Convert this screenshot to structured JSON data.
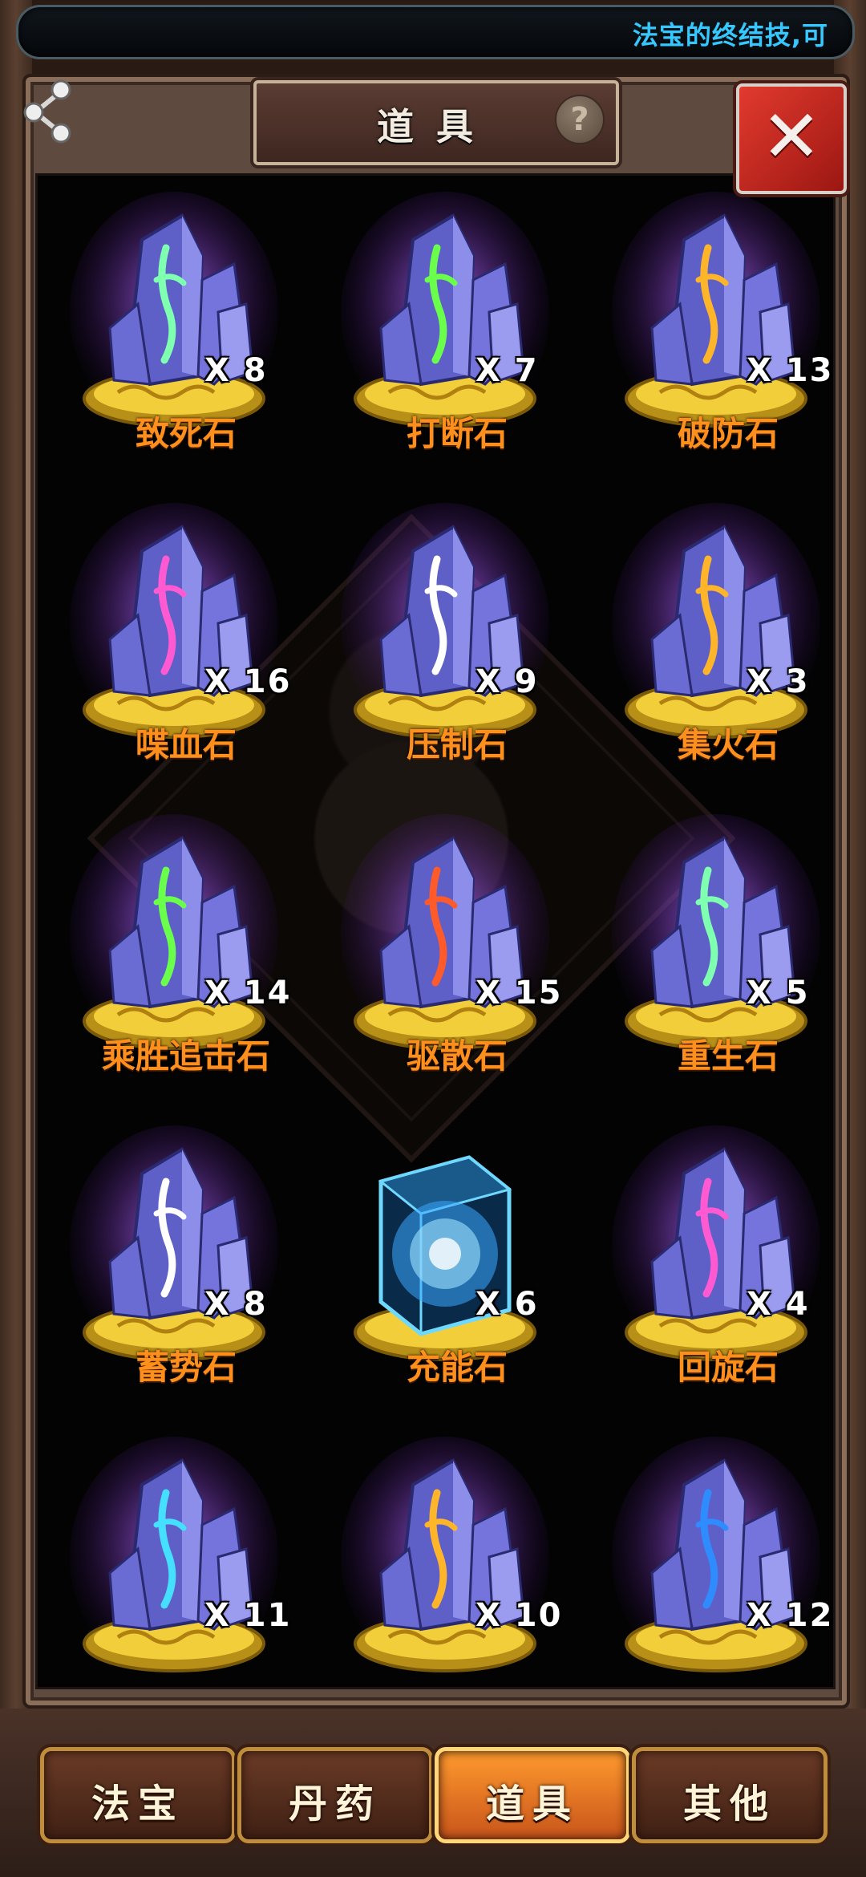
{
  "marquee": {
    "text": "法宝的终结技,可"
  },
  "header": {
    "title": "道具",
    "help_label": "?",
    "close_label": "✕"
  },
  "items": [
    {
      "name": "致死石",
      "count": "X 8",
      "rune_color": "#7fffb0",
      "kind": "crystal"
    },
    {
      "name": "打断石",
      "count": "X 7",
      "rune_color": "#6aff4a",
      "kind": "crystal"
    },
    {
      "name": "破防石",
      "count": "X 13",
      "rune_color": "#ffb52a",
      "kind": "crystal"
    },
    {
      "name": "喋血石",
      "count": "X 16",
      "rune_color": "#ff5ad2",
      "kind": "crystal"
    },
    {
      "name": "压制石",
      "count": "X 9",
      "rune_color": "#ffffff",
      "kind": "crystal"
    },
    {
      "name": "集火石",
      "count": "X 3",
      "rune_color": "#ffb52a",
      "kind": "crystal"
    },
    {
      "name": "乘胜追击石",
      "count": "X 14",
      "rune_color": "#6aff4a",
      "kind": "crystal"
    },
    {
      "name": "驱散石",
      "count": "X 15",
      "rune_color": "#ff5a2a",
      "kind": "crystal"
    },
    {
      "name": "重生石",
      "count": "X 5",
      "rune_color": "#7fffb0",
      "kind": "crystal"
    },
    {
      "name": "蓄势石",
      "count": "X 8",
      "rune_color": "#ffffff",
      "kind": "crystal"
    },
    {
      "name": "充能石",
      "count": "X 6",
      "rune_color": "#3aa8ff",
      "kind": "cube"
    },
    {
      "name": "回旋石",
      "count": "X 4",
      "rune_color": "#ff5ad2",
      "kind": "crystal"
    },
    {
      "name": "",
      "count": "X 11",
      "rune_color": "#45e0ff",
      "kind": "crystal"
    },
    {
      "name": "",
      "count": "X 10",
      "rune_color": "#ffb52a",
      "kind": "crystal"
    },
    {
      "name": "",
      "count": "X 12",
      "rune_color": "#2f8cff",
      "kind": "crystal"
    }
  ],
  "tabs": [
    {
      "label": "法宝",
      "active": false
    },
    {
      "label": "丹药",
      "active": false
    },
    {
      "label": "道具",
      "active": true
    },
    {
      "label": "其他",
      "active": false
    }
  ],
  "colors": {
    "name_orange": "#ff8f1c",
    "accent_red": "#c8201a",
    "marquee_blue": "#35c8ff"
  },
  "icons": {
    "share": "share-icon",
    "help": "question-icon",
    "close": "close-icon"
  }
}
